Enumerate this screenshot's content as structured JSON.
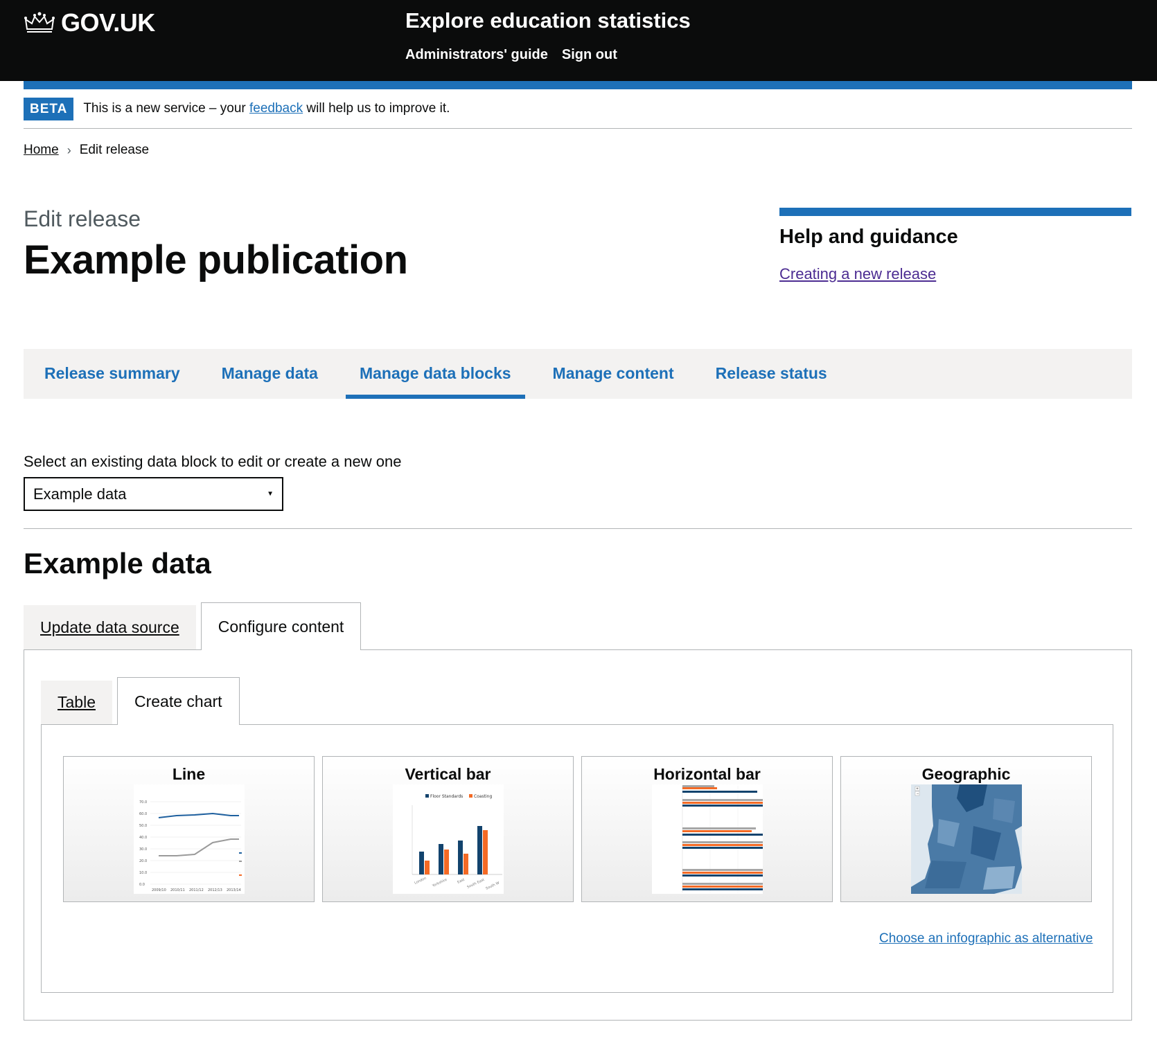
{
  "header": {
    "logo_text": "GOV.UK",
    "service_name": "Explore education statistics",
    "nav": [
      "Administrators' guide",
      "Sign out"
    ]
  },
  "phase_banner": {
    "tag": "BETA",
    "text_before": "This is a new service – your ",
    "link": "feedback",
    "text_after": " will help us to improve it."
  },
  "breadcrumb": {
    "home": "Home",
    "current": "Edit release"
  },
  "page": {
    "caption": "Edit release",
    "title": "Example publication"
  },
  "help": {
    "title": "Help and guidance",
    "link": "Creating a new release"
  },
  "nav_tabs": [
    "Release summary",
    "Manage data",
    "Manage data blocks",
    "Manage content",
    "Release status"
  ],
  "nav_tabs_active": "Manage data blocks",
  "select": {
    "label": "Select an existing data block to edit or create a new one",
    "value": "Example data"
  },
  "section_title": "Example data",
  "outer_tabs": {
    "update": "Update data source",
    "configure": "Configure content"
  },
  "inner_tabs": {
    "table": "Table",
    "chart": "Create chart"
  },
  "chart_types": [
    "Line",
    "Vertical bar",
    "Horizontal bar",
    "Geographic"
  ],
  "thumbnails": {
    "line_yticks": [
      "70.0",
      "60.0",
      "50.0",
      "40.0",
      "30.0",
      "20.0",
      "10.0",
      "0.0"
    ],
    "line_xticks": [
      "2009/10",
      "2010/11",
      "2011/12",
      "2012/13",
      "2013/14"
    ],
    "vbar_legend": [
      "Floor Standards",
      "Coasting"
    ],
    "vbar_categories": [
      "London",
      "Yorkshire",
      "East",
      "South East",
      "South W"
    ]
  },
  "infographic_link": "Choose an infographic as alternative",
  "colors": {
    "brand_blue": "#1d70b8",
    "dark_blue": "#12436d",
    "orange": "#f46a25",
    "header_black": "#0b0c0c"
  }
}
